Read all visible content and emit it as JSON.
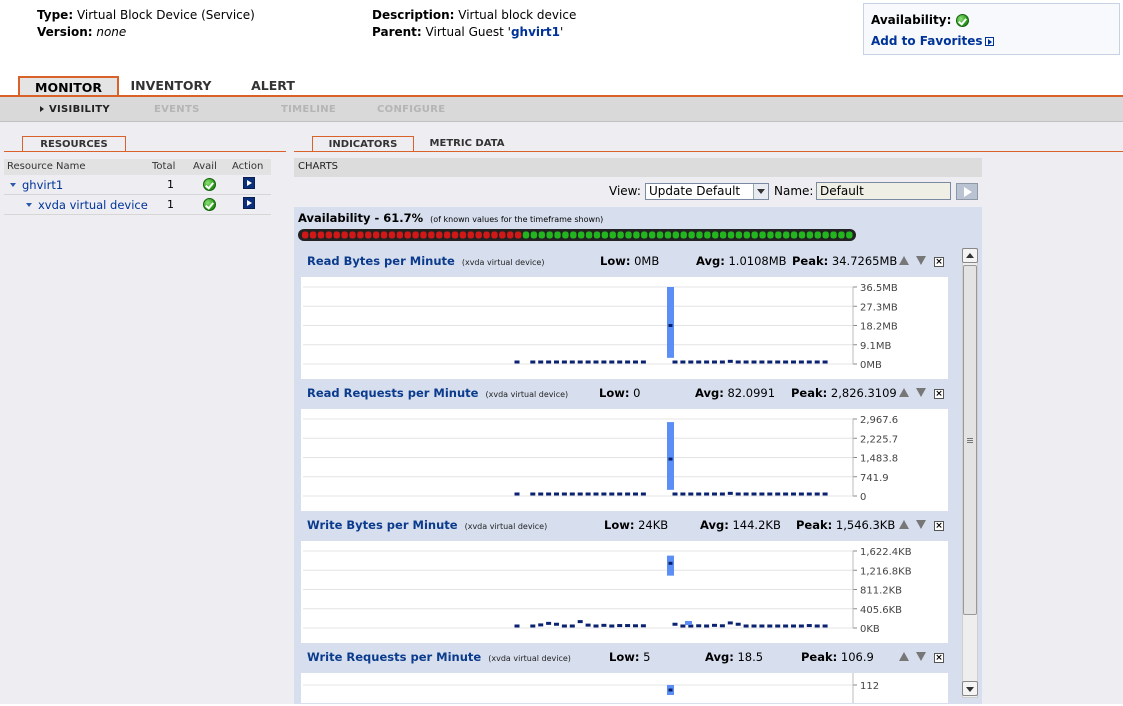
{
  "header": {
    "type_label": "Type:",
    "type_value": "Virtual Block Device (Service)",
    "version_label": "Version:",
    "version_value": "none",
    "description_label": "Description:",
    "description_value": "Virtual block device",
    "parent_label": "Parent:",
    "parent_prefix": "Virtual Guest '",
    "parent_link": "ghvirt1",
    "parent_suffix": "'",
    "availability_label": "Availability:",
    "add_favorites": "Add to Favorites"
  },
  "main_tabs": [
    {
      "label": "MONITOR",
      "active": true
    },
    {
      "label": "INVENTORY",
      "active": false
    },
    {
      "label": "ALERT",
      "active": false
    }
  ],
  "sub_tabs": [
    {
      "label": "VISIBILITY",
      "active": true
    },
    {
      "label": "EVENTS",
      "active": false
    },
    {
      "label": "TIMELINE",
      "active": false
    },
    {
      "label": "CONFIGURE",
      "active": false
    }
  ],
  "resources": {
    "tab_label": "RESOURCES",
    "columns": [
      "Resource Name",
      "Total",
      "Avail",
      "Action"
    ],
    "rows": [
      {
        "name": "ghvirt1",
        "total": "1"
      },
      {
        "name": "xvda virtual device",
        "total": "1"
      }
    ]
  },
  "indicators": {
    "tabs": [
      "INDICATORS",
      "METRIC DATA"
    ],
    "charts_label": "CHARTS",
    "view_label": "View:",
    "view_value": "Update Default",
    "name_label": "Name:",
    "name_value": "Default",
    "availability_title": "Availability - 61.7%",
    "availability_note": "(of known values for the timeframe shown)",
    "availability_pattern": {
      "red": 28,
      "green": 42
    }
  },
  "metrics": [
    {
      "title": "Read Bytes per Minute",
      "subtitle": "(xvda virtual device)",
      "low_label": "Low:",
      "low": "0MB",
      "avg_label": "Avg:",
      "avg": "1.0108MB",
      "peak_label": "Peak:",
      "peak": "34.7265MB",
      "yticks": [
        "36.5MB",
        "27.3MB",
        "18.2MB",
        "9.1MB",
        "0MB"
      ],
      "points": [
        0,
        null,
        0,
        0,
        0,
        0,
        0,
        0,
        0,
        0,
        0,
        0,
        0,
        0,
        0,
        0,
        0,
        null,
        null,
        null,
        0,
        0,
        0,
        0,
        0,
        0,
        0,
        0.3,
        0,
        0,
        0,
        0,
        0,
        0,
        0,
        0,
        0,
        0,
        0,
        0
      ],
      "spike": {
        "index": 18,
        "top": 1.0,
        "mid": 0.5
      }
    },
    {
      "title": "Read Requests per Minute",
      "subtitle": "(xvda virtual device)",
      "low_label": "Low:",
      "low": "0",
      "avg_label": "Avg:",
      "avg": "82.0991",
      "peak_label": "Peak:",
      "peak": "2,826.3109",
      "yticks": [
        "2,967.6",
        "2,225.7",
        "1,483.8",
        "741.9",
        "0"
      ],
      "points": [
        0,
        null,
        0,
        0,
        0,
        0,
        0,
        0,
        0,
        0,
        0,
        0,
        0,
        0,
        0,
        0,
        0,
        null,
        null,
        null,
        0,
        0,
        0,
        0,
        0,
        0,
        0,
        0.3,
        0,
        0,
        0,
        0,
        0,
        0,
        0,
        0,
        0,
        0,
        0,
        0
      ],
      "spike": {
        "index": 18,
        "top": 0.96,
        "mid": 0.48
      }
    },
    {
      "title": "Write Bytes per Minute",
      "subtitle": "(xvda virtual device)",
      "low_label": "Low:",
      "low": "24KB",
      "avg_label": "Avg:",
      "avg": "144.2KB",
      "peak_label": "Peak:",
      "peak": "1,546.3KB",
      "yticks": [
        "1,622.4KB",
        "1,216.8KB",
        "811.2KB",
        "405.6KB",
        "0KB"
      ],
      "points": [
        0,
        null,
        0,
        0.5,
        1.2,
        0.8,
        0,
        0,
        2.0,
        0.4,
        0,
        0.3,
        0,
        0.2,
        0.2,
        0.1,
        0.1,
        null,
        null,
        null,
        0.8,
        0,
        0,
        0.1,
        0,
        0.3,
        0.1,
        1.4,
        0.8,
        0,
        0,
        0,
        0,
        0,
        0,
        0,
        0,
        0.2,
        0,
        0
      ],
      "spike": {
        "index": 18,
        "top": 0.94,
        "mid": 0.84
      }
    },
    {
      "title": "Write Requests per Minute",
      "subtitle": "(xvda virtual device)",
      "low_label": "Low:",
      "low": "5",
      "avg_label": "Avg:",
      "avg": "18.5",
      "peak_label": "Peak:",
      "peak": "106.9",
      "yticks": [
        "112"
      ],
      "points": [],
      "spike": {
        "index": 18,
        "top": 0.3,
        "mid": 0.2
      }
    }
  ]
}
